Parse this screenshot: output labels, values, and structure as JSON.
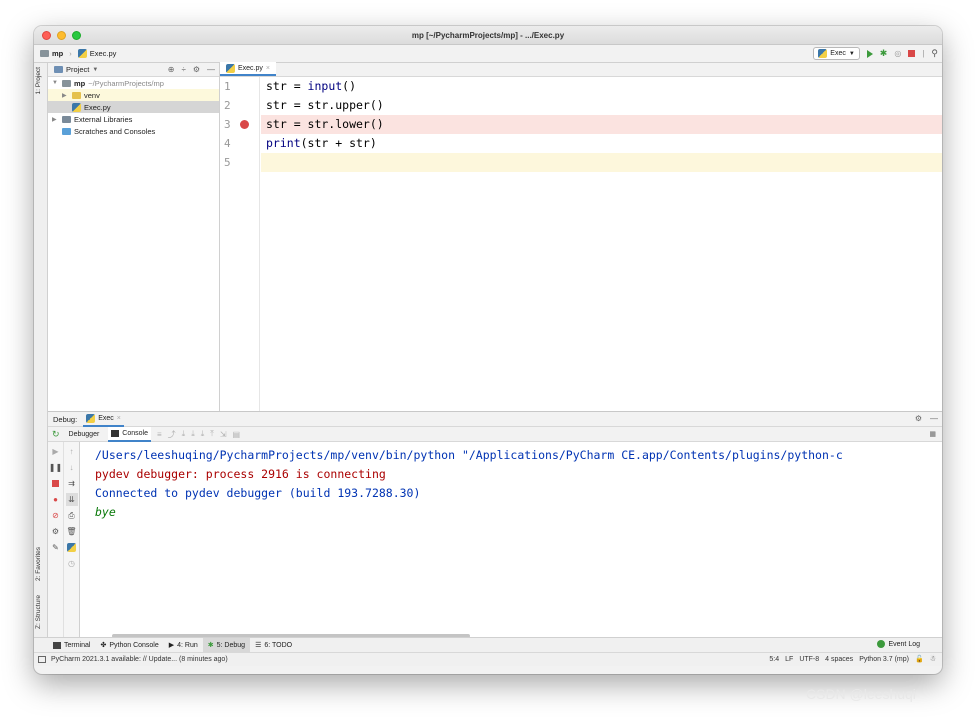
{
  "window": {
    "title": "mp [~/PycharmProjects/mp] - .../Exec.py"
  },
  "navbar": {
    "crumb_project": "mp",
    "crumb_file": "Exec.py",
    "run_config": "Exec"
  },
  "left_tabs": {
    "project": "1: Project",
    "favorites": "2: Favorites",
    "structure": "Z: Structure"
  },
  "project_panel": {
    "header": "Project",
    "root_name": "mp",
    "root_path": "~/PycharmProjects/mp",
    "items": [
      {
        "label": "venv"
      },
      {
        "label": "Exec.py"
      },
      {
        "label": "External Libraries"
      },
      {
        "label": "Scratches and Consoles"
      }
    ]
  },
  "editor": {
    "tab": "Exec.py",
    "line_numbers": [
      "1",
      "2",
      "3",
      "4",
      "5"
    ],
    "lines": [
      {
        "a": "str = ",
        "b": "input",
        "c": "()"
      },
      {
        "a": "str = str.upper()",
        "b": "",
        "c": ""
      },
      {
        "a": "str = str.lower()",
        "b": "",
        "c": ""
      },
      {
        "a": "",
        "b": "print",
        "c": "(str + str)"
      },
      {
        "a": "",
        "b": "",
        "c": ""
      }
    ]
  },
  "debug": {
    "label": "Debug:",
    "tab": "Exec",
    "sub_debugger": "Debugger",
    "sub_console": "Console",
    "console_lines": [
      "/Users/leeshuqing/PycharmProjects/mp/venv/bin/python \"/Applications/PyCharm CE.app/Contents/plugins/python-c",
      "pydev debugger: process 2916 is connecting",
      "",
      "Connected to pydev debugger (build 193.7288.30)",
      "bye"
    ]
  },
  "bottom_tabs": {
    "terminal": "Terminal",
    "python_console": "Python Console",
    "run": "4: Run",
    "debug": "5: Debug",
    "todo": "6: TODO",
    "event_log": "Event Log"
  },
  "status": {
    "message": "PyCharm 2021.3.1 available: // Update... (8 minutes ago)",
    "position": "5:4",
    "line_sep": "LF",
    "encoding": "UTF-8",
    "indent": "4 spaces",
    "interpreter": "Python 3.7 (mp)"
  },
  "watermark": "CSDN @leeshuqi"
}
